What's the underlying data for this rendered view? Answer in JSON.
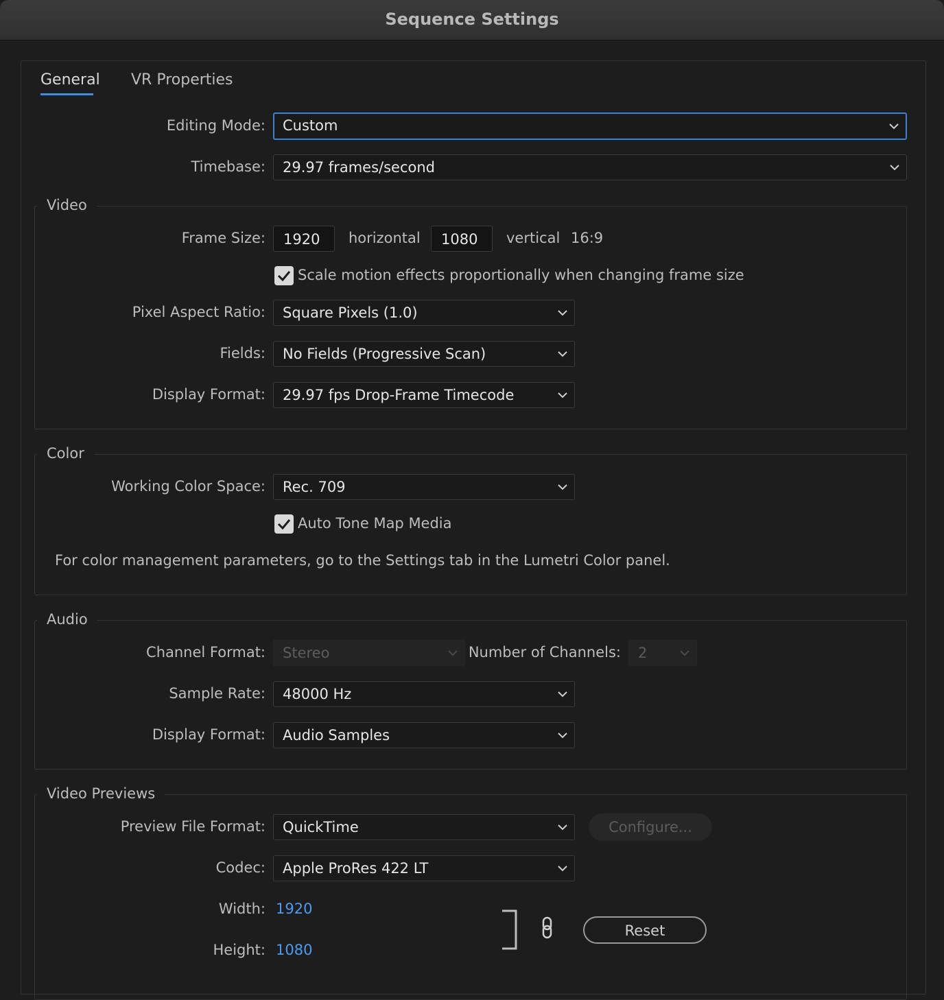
{
  "window": {
    "title": "Sequence Settings"
  },
  "tabs": [
    {
      "label": "General",
      "active": true
    },
    {
      "label": "VR Properties",
      "active": false
    }
  ],
  "editing_mode": {
    "label": "Editing Mode:",
    "value": "Custom"
  },
  "timebase": {
    "label": "Timebase:",
    "value": "29.97  frames/second"
  },
  "video": {
    "legend": "Video",
    "frame_size_label": "Frame Size:",
    "width": "1920",
    "horizontal_label": "horizontal",
    "height": "1080",
    "vertical_label": "vertical",
    "aspect": "16:9",
    "scale_motion": {
      "label": "Scale motion effects proportionally when changing frame size",
      "checked": true
    },
    "pixel_aspect": {
      "label": "Pixel Aspect Ratio:",
      "value": "Square Pixels (1.0)"
    },
    "fields": {
      "label": "Fields:",
      "value": "No Fields (Progressive Scan)"
    },
    "display_format": {
      "label": "Display Format:",
      "value": "29.97 fps Drop-Frame Timecode"
    }
  },
  "color": {
    "legend": "Color",
    "working_space": {
      "label": "Working Color Space:",
      "value": "Rec. 709"
    },
    "auto_tone_map": {
      "label": "Auto Tone Map Media",
      "checked": true
    },
    "note": "For color management parameters, go to the Settings tab in the Lumetri Color panel."
  },
  "audio": {
    "legend": "Audio",
    "channel_format": {
      "label": "Channel Format:",
      "value": "Stereo"
    },
    "num_channels": {
      "label": "Number of Channels:",
      "value": "2"
    },
    "sample_rate": {
      "label": "Sample Rate:",
      "value": "48000 Hz"
    },
    "display_format": {
      "label": "Display Format:",
      "value": "Audio Samples"
    }
  },
  "previews": {
    "legend": "Video Previews",
    "file_format": {
      "label": "Preview File Format:",
      "value": "QuickTime"
    },
    "configure_label": "Configure...",
    "codec": {
      "label": "Codec:",
      "value": "Apple ProRes 422 LT"
    },
    "width": {
      "label": "Width:",
      "value": "1920"
    },
    "height": {
      "label": "Height:",
      "value": "1080"
    },
    "reset_label": "Reset"
  },
  "colors": {
    "accent": "#3b82d6",
    "link": "#4a9cf0",
    "background": "#1d1d1d"
  },
  "icons": {
    "dropdown": "chevron-down-icon",
    "checkbox": "checkmark-icon",
    "link": "chain-link-icon"
  }
}
